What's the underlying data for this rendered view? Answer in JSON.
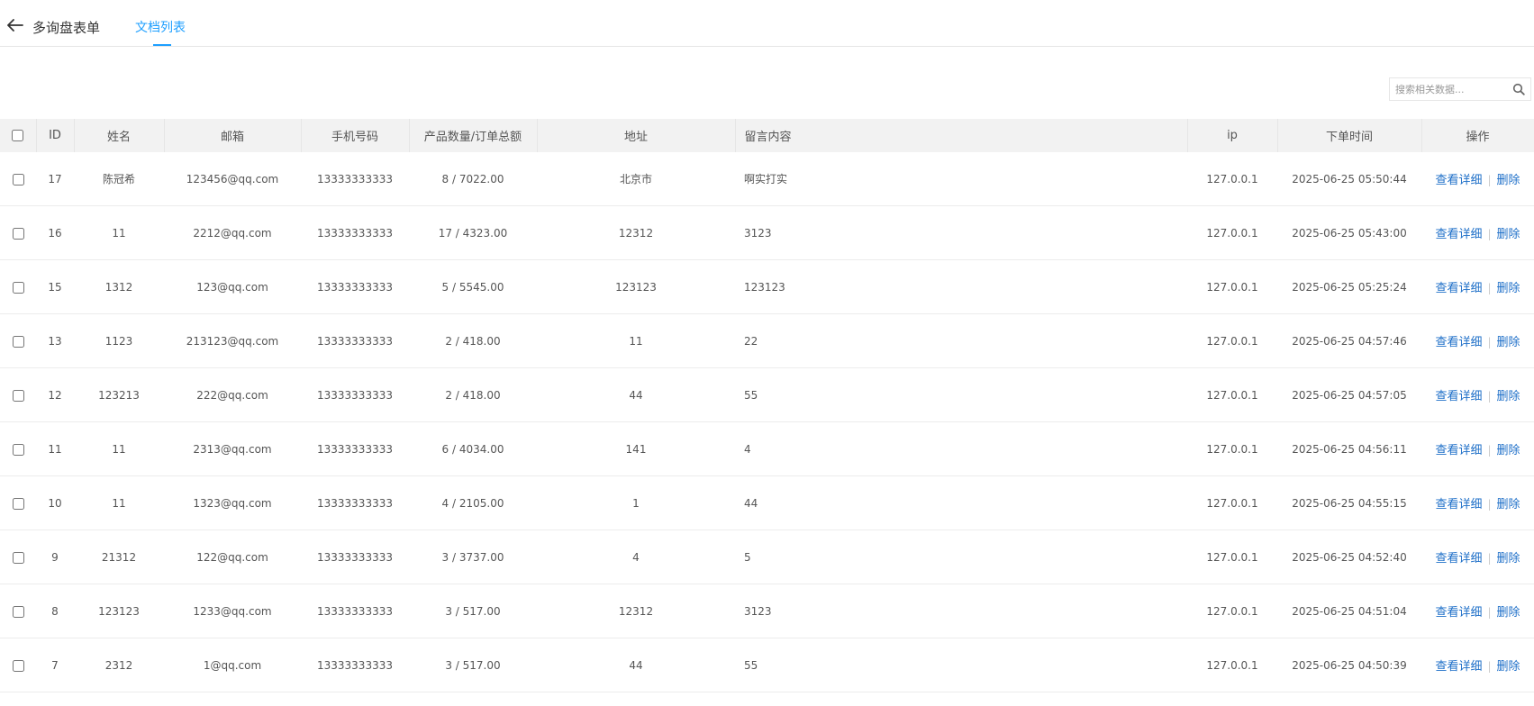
{
  "header": {
    "back_label": "多询盘表单",
    "tab_label": "文档列表"
  },
  "search": {
    "placeholder": "搜索相关数据..."
  },
  "table": {
    "columns": [
      "ID",
      "姓名",
      "邮箱",
      "手机号码",
      "产品数量/订单总额",
      "地址",
      "留言内容",
      "ip",
      "下单时间",
      "操作"
    ],
    "actions": {
      "view": "查看详细",
      "separator": "|",
      "delete": "删除"
    },
    "rows": [
      {
        "id": "17",
        "name": "陈冠希",
        "email": "123456@qq.com",
        "phone": "13333333333",
        "qty_total": "8 / 7022.00",
        "address": "北京市",
        "message": "啊实打实",
        "ip": "127.0.0.1",
        "time": "2025-06-25 05:50:44"
      },
      {
        "id": "16",
        "name": "11",
        "email": "2212@qq.com",
        "phone": "13333333333",
        "qty_total": "17 / 4323.00",
        "address": "12312",
        "message": "3123",
        "ip": "127.0.0.1",
        "time": "2025-06-25 05:43:00"
      },
      {
        "id": "15",
        "name": "1312",
        "email": "123@qq.com",
        "phone": "13333333333",
        "qty_total": "5 / 5545.00",
        "address": "123123",
        "message": "123123",
        "ip": "127.0.0.1",
        "time": "2025-06-25 05:25:24"
      },
      {
        "id": "13",
        "name": "1123",
        "email": "213123@qq.com",
        "phone": "13333333333",
        "qty_total": "2 / 418.00",
        "address": "11",
        "message": "22",
        "ip": "127.0.0.1",
        "time": "2025-06-25 04:57:46"
      },
      {
        "id": "12",
        "name": "123213",
        "email": "222@qq.com",
        "phone": "13333333333",
        "qty_total": "2 / 418.00",
        "address": "44",
        "message": "55",
        "ip": "127.0.0.1",
        "time": "2025-06-25 04:57:05"
      },
      {
        "id": "11",
        "name": "11",
        "email": "2313@qq.com",
        "phone": "13333333333",
        "qty_total": "6 / 4034.00",
        "address": "141",
        "message": "4",
        "ip": "127.0.0.1",
        "time": "2025-06-25 04:56:11"
      },
      {
        "id": "10",
        "name": "11",
        "email": "1323@qq.com",
        "phone": "13333333333",
        "qty_total": "4 / 2105.00",
        "address": "1",
        "message": "44",
        "ip": "127.0.0.1",
        "time": "2025-06-25 04:55:15"
      },
      {
        "id": "9",
        "name": "21312",
        "email": "122@qq.com",
        "phone": "13333333333",
        "qty_total": "3 / 3737.00",
        "address": "4",
        "message": "5",
        "ip": "127.0.0.1",
        "time": "2025-06-25 04:52:40"
      },
      {
        "id": "8",
        "name": "123123",
        "email": "1233@qq.com",
        "phone": "13333333333",
        "qty_total": "3 / 517.00",
        "address": "12312",
        "message": "3123",
        "ip": "127.0.0.1",
        "time": "2025-06-25 04:51:04"
      },
      {
        "id": "7",
        "name": "2312",
        "email": "1@qq.com",
        "phone": "13333333333",
        "qty_total": "3 / 517.00",
        "address": "44",
        "message": "55",
        "ip": "127.0.0.1",
        "time": "2025-06-25 04:50:39"
      }
    ]
  }
}
